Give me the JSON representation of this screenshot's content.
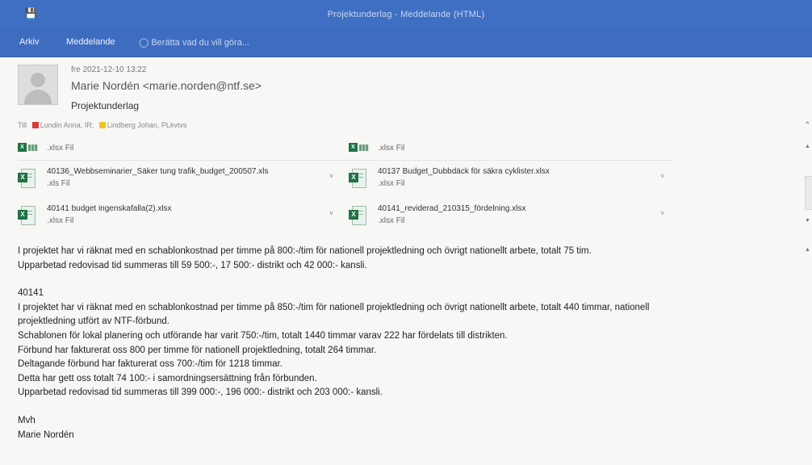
{
  "window": {
    "title": "Projektunderlag - Meddelande (HTML)",
    "save_icon": "save-icon"
  },
  "ribbon": {
    "tabs": [
      "Arkiv",
      "Meddelande"
    ],
    "tell_me": "Berätta vad du vill göra..."
  },
  "message": {
    "date": "fre 2021-12-10 13:22",
    "sender": "Marie Nordén <marie.norden@ntf.se>",
    "subject": "Projektunderlag",
    "to_label": "Till",
    "recipients": [
      {
        "name": "Lundin Anna, IR;",
        "color": "#d83b3b"
      },
      {
        "name": "Lindberg Johan, PLkvtvs",
        "color": "#f2c51e"
      }
    ]
  },
  "attachments": {
    "top": [
      {
        "type": ".xlsx Fil"
      },
      {
        "type": ".xlsx Fil"
      }
    ],
    "files": [
      {
        "name": "40136_Webbseminarier_Säker tung trafik_budget_200507.xls",
        "type": ".xls Fil"
      },
      {
        "name": "40137 Budget_Dubbdäck för säkra cyklister.xlsx",
        "type": ".xlsx Fil"
      },
      {
        "name": "40141 budget ingenskafalla(2).xlsx",
        "type": ".xlsx Fil"
      },
      {
        "name": "40141_reviderad_210315_fördelning.xlsx",
        "type": ".xlsx Fil"
      }
    ]
  },
  "body": {
    "para1": [
      "I projektet har vi räknat med en schablonkostnad per timme på 800:-/tim för nationell projektledning och övrigt nationellt arbete, totalt 75 tim.",
      "Upparbetad redovisad tid summeras till 59 500:-, 17 500:- distrikt och 42 000:- kansli."
    ],
    "para2": [
      "40141",
      "I projektet har vi räknat med en schablonkostnad per timme på 850:-/tim för nationell projektledning och övrigt nationellt arbete, totalt 440 timmar, nationell",
      "projektledning utfört av NTF-förbund.",
      "Schablonen för lokal planering och utförande har varit 750:-/tim, totalt 1440 timmar varav 222 har fördelats till distrikten.",
      "Förbund har fakturerat oss 800 per timme för nationell projektledning, totalt 264 timmar.",
      "Deltagande förbund har fakturerat oss 700:-/tim för 1218 timmar.",
      "Detta har gett oss totalt 74 100:- i samordningsersättning från förbunden.",
      "Upparbetad redovisad tid summeras till 399 000:-, 196 000:- distrikt och 203 000:- kansli."
    ],
    "closing": [
      "Mvh",
      "Marie Nordén"
    ]
  }
}
